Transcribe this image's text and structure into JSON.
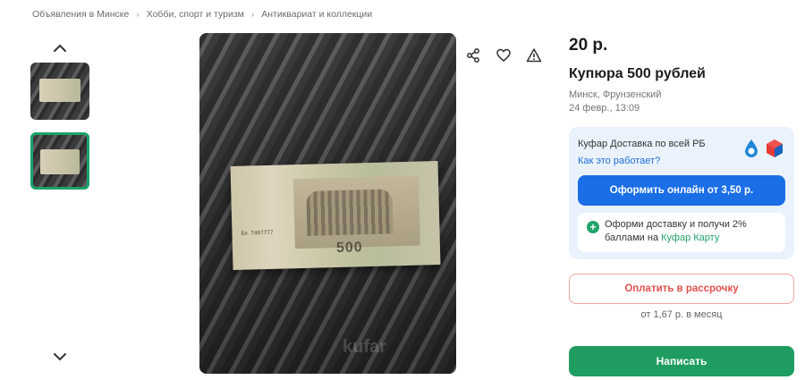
{
  "breadcrumb": {
    "items": [
      "Объявления в Минске",
      "Хобби, спорт и туризм",
      "Антиквариат и коллекции"
    ],
    "separator": "›"
  },
  "gallery": {
    "up_icon": "chevron-up-icon",
    "down_icon": "chevron-down-icon",
    "thumbnails": 2,
    "selected_thumbnail": 2,
    "banknote_value": "500",
    "banknote_serial": "Ба 7467777",
    "watermark": "kufar"
  },
  "actions": {
    "share_icon": "share-icon",
    "favorite_icon": "heart-icon",
    "report_icon": "warning-icon"
  },
  "listing": {
    "price": "20 р.",
    "title": "Купюра 500 рублей",
    "location": "Минск, Фрунзенский",
    "date": "24 февр., 13:09"
  },
  "delivery": {
    "title": "Куфар Доставка по всей РБ",
    "how_link": "Как это работает?",
    "order_button": "Оформить онлайн от 3,50 р.",
    "promo_text": "Оформи доставку и получи 2% баллами на ",
    "promo_link": "Куфар Карту"
  },
  "payment": {
    "installment_button": "Оплатить в рассрочку",
    "installment_note": "от 1,67 р. в месяц"
  },
  "contact": {
    "write_button": "Написать"
  },
  "colors": {
    "accent_blue": "#1a6ee6",
    "accent_green": "#1f9d60",
    "installment_red": "#e0524d",
    "delivery_bg": "#eaf3fd"
  }
}
